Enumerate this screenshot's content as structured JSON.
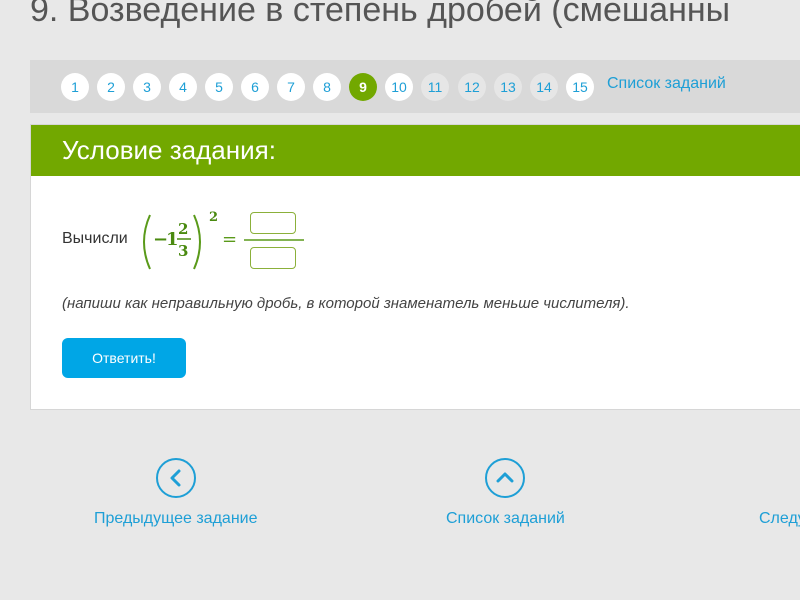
{
  "page": {
    "title": "9. Возведение в степень дробей (смешанны"
  },
  "task_nav": {
    "items": [
      {
        "label": "1",
        "state": "normal"
      },
      {
        "label": "2",
        "state": "normal"
      },
      {
        "label": "3",
        "state": "normal"
      },
      {
        "label": "4",
        "state": "normal"
      },
      {
        "label": "5",
        "state": "normal"
      },
      {
        "label": "6",
        "state": "normal"
      },
      {
        "label": "7",
        "state": "normal"
      },
      {
        "label": "8",
        "state": "normal"
      },
      {
        "label": "9",
        "state": "active"
      },
      {
        "label": "10",
        "state": "normal"
      },
      {
        "label": "11",
        "state": "dim"
      },
      {
        "label": "12",
        "state": "dim"
      },
      {
        "label": "13",
        "state": "dim"
      },
      {
        "label": "14",
        "state": "dim"
      },
      {
        "label": "15",
        "state": "normal"
      }
    ],
    "list_link": "Список заданий"
  },
  "task": {
    "header": "Условие задания:",
    "prompt": "Вычисли",
    "expression": {
      "sign": "−",
      "whole": "1",
      "numerator": "2",
      "denominator": "3",
      "exponent": "2",
      "equals": "="
    },
    "numerator_input": {
      "value": "",
      "placeholder": ""
    },
    "denominator_input": {
      "value": "",
      "placeholder": ""
    },
    "hint": "(напиши как неправильную дробь, в которой знаменатель меньше числителя).",
    "submit_label": "Ответить!"
  },
  "bottom_nav": {
    "prev_label": "Предыдущее задание",
    "list_label": "Список заданий",
    "next_label": "Следу"
  },
  "colors": {
    "accent_green": "#72a800",
    "link_blue": "#1e9fd6",
    "button_blue": "#00a6e6"
  }
}
